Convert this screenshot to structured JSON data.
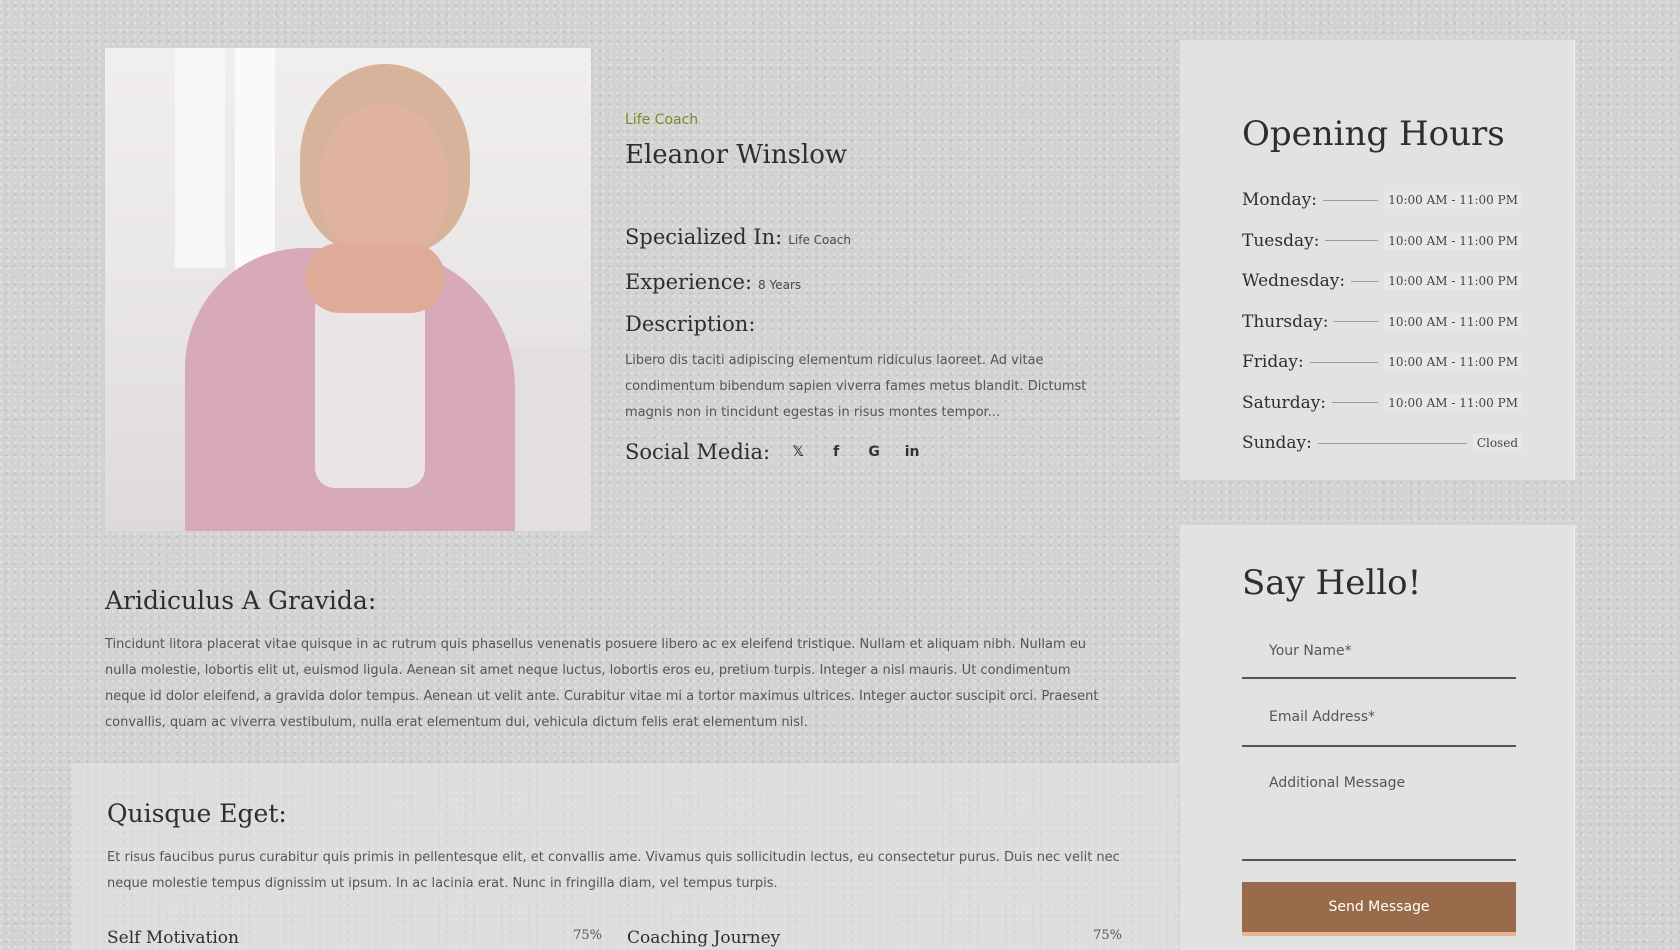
{
  "profile": {
    "role": "Life Coach",
    "name": "Eleanor Winslow",
    "specialized_label": "Specialized In:",
    "specialized_value": "Life Coach",
    "experience_label": "Experience:",
    "experience_value": "8 Years",
    "description_label": "Description:",
    "description": "Libero dis taciti adipiscing elementum ridiculus laoreet. Ad vitae condimentum bibendum sapien viverra fames metus blandit. Dictumst magnis non in tincidunt egestas in risus montes tempor...",
    "social_label": "Social Media:",
    "social_icons": [
      "x-icon",
      "facebook-icon",
      "google-icon",
      "linkedin-icon"
    ],
    "social_glyphs": [
      "𝕏",
      "f",
      "G",
      "in"
    ]
  },
  "section1": {
    "heading": "Aridiculus A Gravida:",
    "text": "Tincidunt litora placerat vitae quisque in ac rutrum quis phasellus venenatis posuere libero ac ex eleifend tristique. Nullam et aliquam nibh. Nullam eu nulla molestie, lobortis elit ut, euismod ligula. Aenean sit amet neque luctus, lobortis eros eu, pretium turpis. Integer a nisl mauris. Ut condimentum neque id dolor eleifend, a gravida dolor tempus. Aenean ut velit ante. Curabitur vitae mi a tortor maximus ultrices. Integer auctor suscipit orci. Praesent convallis, quam ac viverra vestibulum, nulla erat elementum dui, vehicula dictum felis erat elementum nisl."
  },
  "section2": {
    "heading": "Quisque Eget:",
    "text": "Et risus faucibus purus curabitur quis primis in pellentesque elit, et convallis ame. Vivamus quis sollicitudin lectus, eu consectetur purus. Duis nec velit nec neque molestie tempus dignissim ut ipsum. In ac lacinia erat. Nunc in fringilla diam, vel tempus turpis."
  },
  "skills": [
    {
      "label": "Self Motivation",
      "percent": "75%"
    },
    {
      "label": "Coaching Journey",
      "percent": "75%"
    }
  ],
  "hours": {
    "title": "Opening Hours",
    "rows": [
      {
        "day": "Monday:",
        "time": "10:00 AM - 11:00 PM"
      },
      {
        "day": "Tuesday:",
        "time": "10:00 AM - 11:00 PM"
      },
      {
        "day": "Wednesday:",
        "time": "10:00 AM - 11:00 PM"
      },
      {
        "day": "Thursday:",
        "time": "10:00 AM - 11:00 PM"
      },
      {
        "day": "Friday:",
        "time": "10:00 AM - 11:00 PM"
      },
      {
        "day": "Saturday:",
        "time": "10:00 AM - 11:00 PM"
      },
      {
        "day": "Sunday:",
        "time": "Closed"
      }
    ]
  },
  "contact": {
    "title": "Say Hello!",
    "name_placeholder": "Your Name*",
    "email_placeholder": "Email Address*",
    "message_placeholder": "Additional Message",
    "send_label": "Send Message"
  },
  "colors": {
    "accent_brown": "#9a6b4b",
    "accent_olive": "#7a8a2a",
    "background": "#d3d3d2"
  }
}
